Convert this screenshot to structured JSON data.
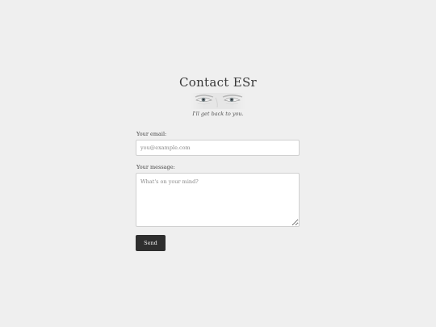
{
  "header": {
    "title": "Contact ESr",
    "subtitle": "I'll get back to you."
  },
  "form": {
    "email_label": "Your email:",
    "email_placeholder": "you@example.com",
    "email_value": "",
    "message_label": "Your message:",
    "message_placeholder": "What's on your mind?",
    "message_value": "",
    "send_label": "Send"
  },
  "icons": {
    "portrait": "eyes-image"
  },
  "colors": {
    "background": "#efefef",
    "button": "#2e2e2e",
    "button_text": "#f2f2f2",
    "text": "#333333"
  }
}
